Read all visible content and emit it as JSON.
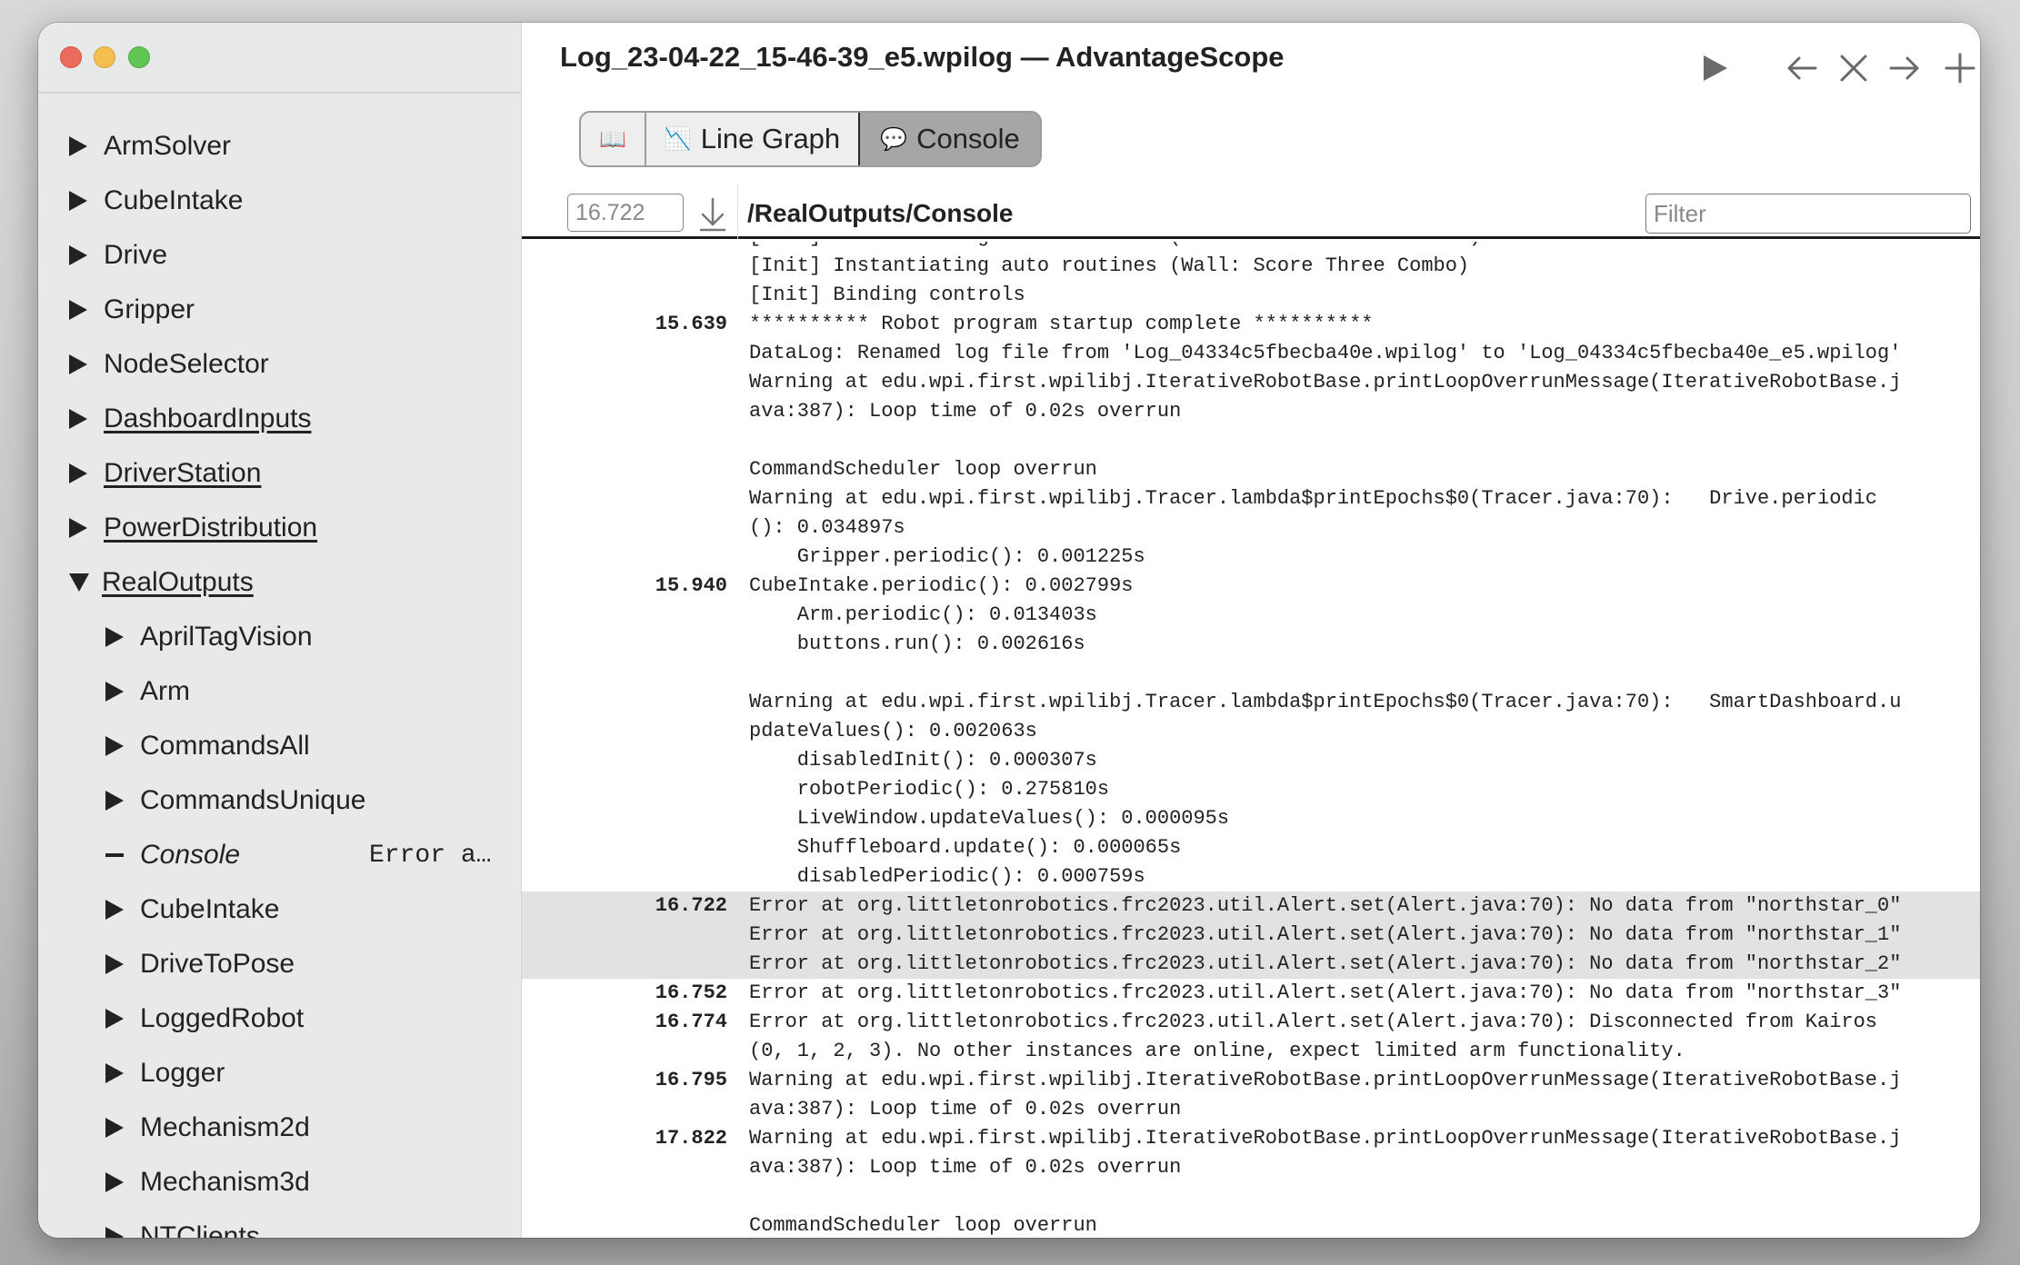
{
  "window": {
    "title": "Log_23-04-22_15-46-39_e5.wpilog — AdvantageScope"
  },
  "toolbar_icons": [
    {
      "name": "play-icon",
      "glyph": "▶"
    },
    {
      "name": "arrow-left-icon",
      "glyph": "←"
    },
    {
      "name": "close-tab-icon",
      "glyph": "✕"
    },
    {
      "name": "arrow-right-icon",
      "glyph": "→"
    },
    {
      "name": "add-tab-icon",
      "glyph": "+"
    }
  ],
  "tabs": [
    {
      "label": "",
      "icon": "📖",
      "name": "tab-documentation",
      "active": false
    },
    {
      "label": "Line Graph",
      "icon": "📉",
      "name": "tab-line-graph",
      "active": false
    },
    {
      "label": "Console",
      "icon": "💬",
      "name": "tab-console",
      "active": true
    }
  ],
  "console": {
    "timestamp_value": "16.722",
    "field_path": "/RealOutputs/Console",
    "filter_placeholder": "Filter"
  },
  "sidebar": {
    "items": [
      {
        "label": "ArmSolver",
        "state": "collapsed",
        "level": 0,
        "underline": false
      },
      {
        "label": "CubeIntake",
        "state": "collapsed",
        "level": 0,
        "underline": false
      },
      {
        "label": "Drive",
        "state": "collapsed",
        "level": 0,
        "underline": false
      },
      {
        "label": "Gripper",
        "state": "collapsed",
        "level": 0,
        "underline": false
      },
      {
        "label": "NodeSelector",
        "state": "collapsed",
        "level": 0,
        "underline": false
      },
      {
        "label": "DashboardInputs",
        "state": "collapsed",
        "level": 0,
        "underline": true
      },
      {
        "label": "DriverStation",
        "state": "collapsed",
        "level": 0,
        "underline": true
      },
      {
        "label": "PowerDistribution",
        "state": "collapsed",
        "level": 0,
        "underline": true
      },
      {
        "label": "RealOutputs",
        "state": "expanded",
        "level": 0,
        "underline": true
      },
      {
        "label": "AprilTagVision",
        "state": "collapsed",
        "level": 1,
        "underline": false
      },
      {
        "label": "Arm",
        "state": "collapsed",
        "level": 1,
        "underline": false
      },
      {
        "label": "CommandsAll",
        "state": "collapsed",
        "level": 1,
        "underline": false
      },
      {
        "label": "CommandsUnique",
        "state": "collapsed",
        "level": 1,
        "underline": false
      },
      {
        "label": "Console",
        "state": "leaf",
        "level": 1,
        "underline": false,
        "italic": true,
        "preview": "Error a…"
      },
      {
        "label": "CubeIntake",
        "state": "collapsed",
        "level": 1,
        "underline": false
      },
      {
        "label": "DriveToPose",
        "state": "collapsed",
        "level": 1,
        "underline": false
      },
      {
        "label": "LoggedRobot",
        "state": "collapsed",
        "level": 1,
        "underline": false
      },
      {
        "label": "Logger",
        "state": "collapsed",
        "level": 1,
        "underline": false
      },
      {
        "label": "Mechanism2d",
        "state": "collapsed",
        "level": 1,
        "underline": false
      },
      {
        "label": "Mechanism3d",
        "state": "collapsed",
        "level": 1,
        "underline": false
      },
      {
        "label": "NTClients",
        "state": "collapsed",
        "level": 1,
        "underline": false
      }
    ]
  },
  "log_entries": [
    {
      "timestamp": "",
      "highlighted": false,
      "lines": [
        "[Init] Instantiating auto routines (Field: Score Three Combo)",
        "[Init] Instantiating auto routines (Wall: Score Three Combo)",
        "[Init] Binding controls"
      ]
    },
    {
      "timestamp": "15.639",
      "highlighted": false,
      "lines": [
        "********** Robot program startup complete **********",
        "DataLog: Renamed log file from 'Log_04334c5fbecba40e.wpilog' to 'Log_04334c5fbecba40e_e5.wpilog'",
        "Warning at edu.wpi.first.wpilibj.IterativeRobotBase.printLoopOverrunMessage(IterativeRobotBase.j",
        "ava:387): Loop time of 0.02s overrun",
        "",
        "CommandScheduler loop overrun",
        "Warning at edu.wpi.first.wpilibj.Tracer.lambda$printEpochs$0(Tracer.java:70):   Drive.periodic",
        "(): 0.034897s",
        "    Gripper.periodic(): 0.001225s"
      ]
    },
    {
      "timestamp": "15.940",
      "highlighted": false,
      "lines": [
        "CubeIntake.periodic(): 0.002799s",
        "    Arm.periodic(): 0.013403s",
        "    buttons.run(): 0.002616s",
        "",
        "Warning at edu.wpi.first.wpilibj.Tracer.lambda$printEpochs$0(Tracer.java:70):   SmartDashboard.u",
        "pdateValues(): 0.002063s",
        "    disabledInit(): 0.000307s",
        "    robotPeriodic(): 0.275810s",
        "    LiveWindow.updateValues(): 0.000095s",
        "    Shuffleboard.update(): 0.000065s",
        "    disabledPeriodic(): 0.000759s"
      ]
    },
    {
      "timestamp": "16.722",
      "highlighted": true,
      "lines": [
        "Error at org.littletonrobotics.frc2023.util.Alert.set(Alert.java:70): No data from \"northstar_0\"",
        "Error at org.littletonrobotics.frc2023.util.Alert.set(Alert.java:70): No data from \"northstar_1\"",
        "Error at org.littletonrobotics.frc2023.util.Alert.set(Alert.java:70): No data from \"northstar_2\""
      ]
    },
    {
      "timestamp": "16.752",
      "highlighted": false,
      "lines": [
        "Error at org.littletonrobotics.frc2023.util.Alert.set(Alert.java:70): No data from \"northstar_3\""
      ]
    },
    {
      "timestamp": "16.774",
      "highlighted": false,
      "lines": [
        "Error at org.littletonrobotics.frc2023.util.Alert.set(Alert.java:70): Disconnected from Kairos",
        "(0, 1, 2, 3). No other instances are online, expect limited arm functionality."
      ]
    },
    {
      "timestamp": "16.795",
      "highlighted": false,
      "lines": [
        "Warning at edu.wpi.first.wpilibj.IterativeRobotBase.printLoopOverrunMessage(IterativeRobotBase.j",
        "ava:387): Loop time of 0.02s overrun"
      ]
    },
    {
      "timestamp": "17.822",
      "highlighted": false,
      "lines": [
        "Warning at edu.wpi.first.wpilibj.IterativeRobotBase.printLoopOverrunMessage(IterativeRobotBase.j",
        "ava:387): Loop time of 0.02s overrun",
        "",
        "CommandScheduler loop overrun"
      ]
    }
  ]
}
